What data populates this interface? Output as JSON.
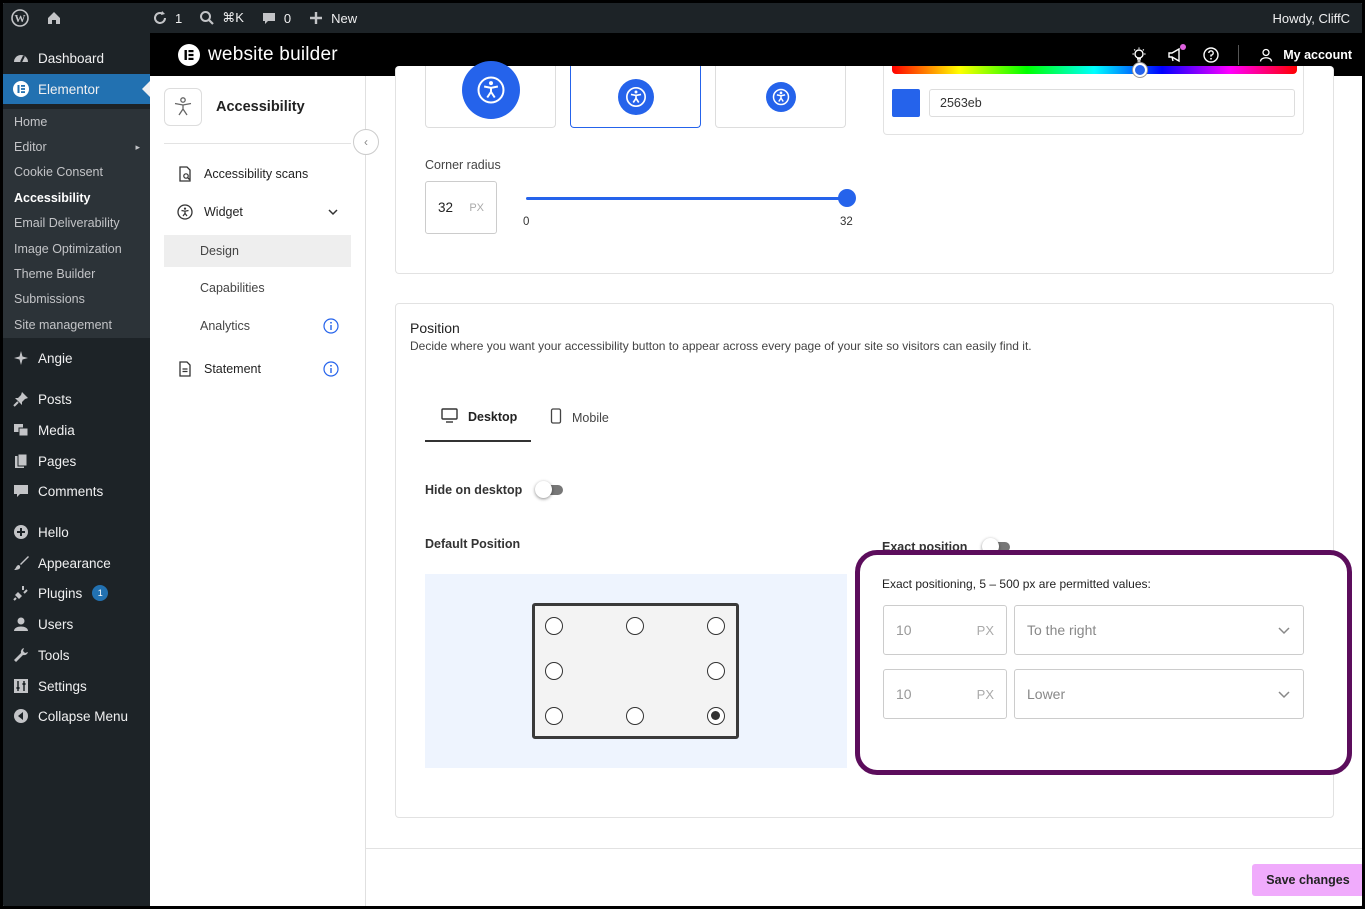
{
  "adminbar": {
    "updates_count": "1",
    "search_shortcut": "⌘K",
    "comments_count": "0",
    "new_label": "New",
    "greeting": "Howdy, CliffC"
  },
  "wp_menu": {
    "dashboard": "Dashboard",
    "elementor": "Elementor",
    "submenu": [
      "Home",
      "Editor",
      "Cookie Consent",
      "Accessibility",
      "Email Deliverability",
      "Image Optimization",
      "Theme Builder",
      "Submissions",
      "Site management"
    ],
    "angie": "Angie",
    "posts": "Posts",
    "media": "Media",
    "pages": "Pages",
    "comments": "Comments",
    "hello": "Hello",
    "appearance": "Appearance",
    "plugins": "Plugins",
    "plugins_badge": "1",
    "users": "Users",
    "tools": "Tools",
    "settings": "Settings",
    "collapse": "Collapse Menu"
  },
  "app_header": {
    "brand": "website builder",
    "account": "My account"
  },
  "plugin_nav": {
    "title": "Accessibility",
    "items": {
      "scans": "Accessibility scans",
      "widget": "Widget",
      "design": "Design",
      "capabilities": "Capabilities",
      "analytics": "Analytics",
      "statement": "Statement"
    }
  },
  "design": {
    "color_hex": "2563eb",
    "corner_radius_label": "Corner radius",
    "corner_radius_value": "32",
    "corner_radius_unit": "PX",
    "slider_min": "0",
    "slider_max": "32",
    "slider_fraction": 1.0
  },
  "position": {
    "title": "Position",
    "description": "Decide where you want your accessibility button to appear across every page of your site so visitors can easily find it.",
    "tabs": {
      "desktop": "Desktop",
      "mobile": "Mobile"
    },
    "hide_label": "Hide on desktop",
    "default_label": "Default Position",
    "exact_label": "Exact position",
    "exact_note": "Exact positioning, 5 – 500 px are permitted values:",
    "horizontal_value": "10",
    "horizontal_unit": "PX",
    "horizontal_dir": "To the right",
    "vertical_value": "10",
    "vertical_unit": "PX",
    "vertical_dir": "Lower",
    "selected_slot": "bottom-right"
  },
  "save_label": "Save changes",
  "colors": {
    "accent": "#2563eb",
    "wp_active": "#2271b1",
    "highlight": "#5c0d5c",
    "save_bg": "#f0abfc"
  }
}
